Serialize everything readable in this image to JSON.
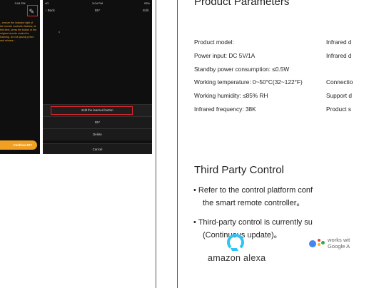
{
  "phone_left": {
    "status_time": "3:04 PM",
    "hint": "...ensure the indicator light of the remote controller flashes; at this time, press the button of the original remote control for learning. Do not quickly press and release...",
    "continue_label": "Continue DIY"
  },
  "phone_right": {
    "status_carrier": "4G",
    "status_time": "3:04 PM",
    "status_battery": "93%",
    "back_label": "Back",
    "title": "DIY",
    "edit_label": "Edit",
    "sheet_items": [
      "Edit the learned button",
      "DIY",
      "Delete",
      "Cancel"
    ]
  },
  "params": {
    "title": "Product Parameters",
    "left": [
      "Product model:",
      "Power input: DC 5V/1A",
      "Standby power consumption: ≤0.5W",
      "Working temperature: 0~50°C(32~122°F)",
      "Working humidity: ≤85% RH",
      "Infrared frequency: 38K"
    ],
    "right": [
      "Infrared d",
      "Infrared d",
      "",
      "Connectio",
      "Support d",
      "Product s"
    ]
  },
  "third_party": {
    "title": "Third Party Control",
    "bullet1_line1": "• Refer to the control platform conf",
    "bullet1_line2": "the smart remote controller。",
    "bullet2_line1": "• Third-party control is currently su",
    "bullet2_line2": "(Continuous update)。"
  },
  "logos": {
    "alexa_text": "amazon alexa",
    "google_line1": "works wit",
    "google_line2": "Google A"
  },
  "colors": {
    "highlight_red": "#e0262c",
    "orange": "#f0a022",
    "alexa_blue": "#31c4f3"
  }
}
